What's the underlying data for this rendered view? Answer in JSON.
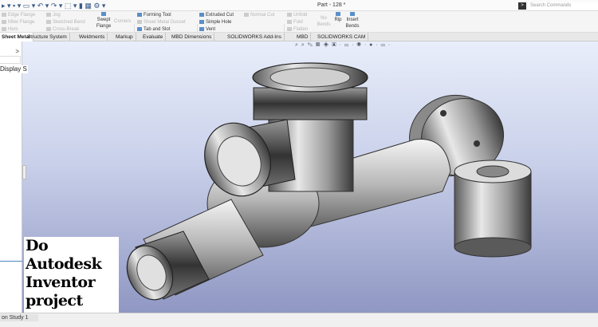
{
  "window": {
    "title": "Part - 128 *",
    "search_placeholder": "Search Commands"
  },
  "quick_access": [
    "new-icon",
    "save-icon",
    "print-icon",
    "undo-icon",
    "redo-icon",
    "select-icon",
    "rebuild-icon",
    "file-properties-icon",
    "options-icon"
  ],
  "ribbon": {
    "col1": [
      "Edge Flange",
      "Miter Flange",
      "Hem"
    ],
    "col2": [
      "Jog",
      "Sketched Bend",
      "Cross-Break"
    ],
    "swept_flange": "Swept Flange",
    "corners": "Corners",
    "col3": [
      "Forming Tool",
      "Sheet Metal Gusset",
      "Tab and Slot"
    ],
    "col4": [
      "Extruded Cut",
      "Simple Hole",
      "Vent"
    ],
    "normal_cut": "Normal Cut",
    "col5": [
      "Unfold",
      "Fold",
      "Flatten"
    ],
    "no_bends": "No Bends",
    "rip": "Rip",
    "insert_bends": "Insert Bends"
  },
  "tabs": [
    {
      "label": "Sheet Metal",
      "active": true
    },
    {
      "label": "Structure System"
    },
    {
      "label": "Weldments"
    },
    {
      "label": "Markup"
    },
    {
      "label": "Evaluate"
    },
    {
      "label": "MBD Dimensions"
    },
    {
      "label": "SOLIDWORKS Add-Ins"
    },
    {
      "label": "MBD"
    },
    {
      "label": "SOLIDWORKS CAM"
    }
  ],
  "left_panel": {
    "expand": ">",
    "display_states": "Display S"
  },
  "overlay": {
    "lines": [
      "Do",
      "Autodesk",
      "Inventor",
      "project"
    ]
  },
  "bottom": {
    "tab": "on Study 1"
  },
  "heads_up_toolbar": "⌕ ⌕ ✎ ▦ ◈ ▣ · ▭ · ◉ · ● · ▭ ·"
}
